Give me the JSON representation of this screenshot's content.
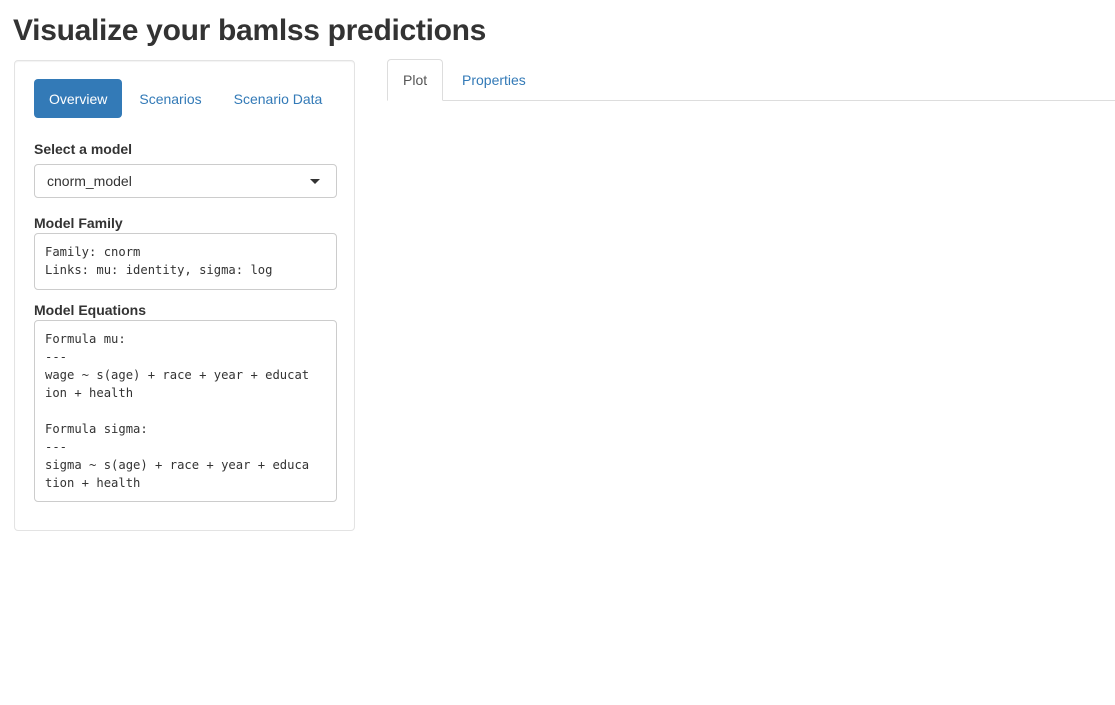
{
  "page": {
    "title": "Visualize your bamlss predictions"
  },
  "sidebar": {
    "nav": [
      {
        "label": "Overview",
        "active": true
      },
      {
        "label": "Scenarios",
        "active": false
      },
      {
        "label": "Scenario Data",
        "active": false
      }
    ],
    "model_select": {
      "label": "Select a model",
      "value": "cnorm_model"
    },
    "model_family": {
      "label": "Model Family",
      "text": "Family: cnorm\nLinks: mu: identity, sigma: log"
    },
    "model_equations": {
      "label": "Model Equations",
      "text": "Formula mu:\n---\nwage ~ s(age) + race + year + educat\nion + health\n\nFormula sigma:\n---\nsigma ~ s(age) + race + year + educa\ntion + health"
    }
  },
  "main": {
    "tabs": [
      {
        "label": "Plot",
        "active": true
      },
      {
        "label": "Properties",
        "active": false
      }
    ]
  },
  "colors": {
    "accent": "#337ab7",
    "text": "#333333",
    "border": "#cccccc"
  },
  "icons": {
    "cursor": "mouse-pointer-icon",
    "dropdown": "caret-down-icon"
  }
}
